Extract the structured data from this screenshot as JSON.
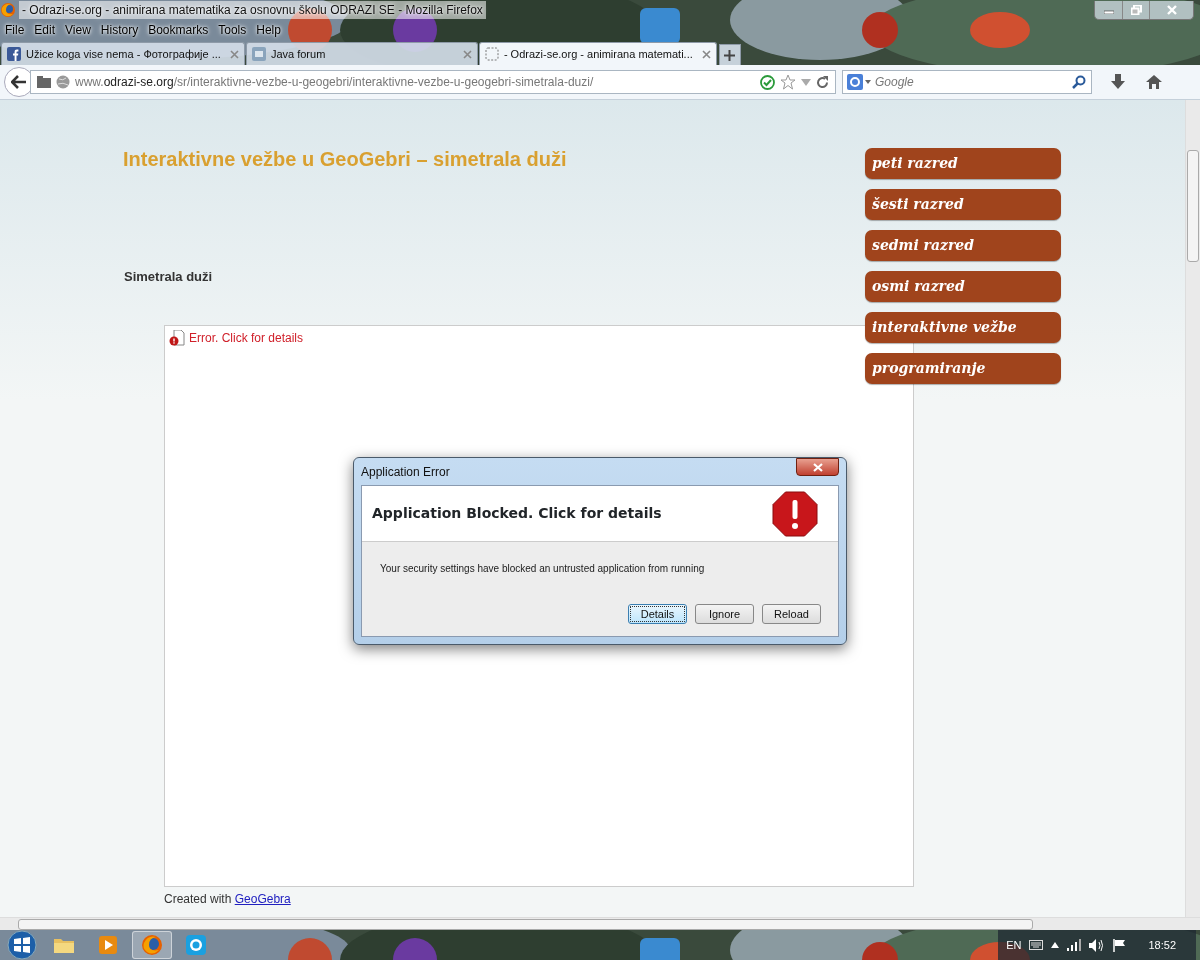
{
  "window": {
    "title": "- Odrazi-se.org - animirana matematika za osnovnu školu ODRAZI SE - Mozilla Firefox"
  },
  "menu": [
    {
      "label": "File"
    },
    {
      "label": "Edit"
    },
    {
      "label": "View"
    },
    {
      "label": "History"
    },
    {
      "label": "Bookmarks"
    },
    {
      "label": "Tools"
    },
    {
      "label": "Help"
    }
  ],
  "tabs": [
    {
      "label": "Užice koga vise nema - Фотографије ...",
      "selected": false
    },
    {
      "label": "Java forum",
      "selected": false
    },
    {
      "label": "- Odrazi-se.org - animirana matemati...",
      "selected": true
    }
  ],
  "address_bar": {
    "value": "www.**odrazi-se.org**/sr/interaktivne-vezbe-u-geogebri/interaktivne-vezbe-u-geogebri-simetrala-duzi/"
  },
  "search": {
    "placeholder": "Google"
  },
  "page": {
    "title": "Interaktivne vežbe u GeoGebri – simetrala duži",
    "subtitle": "Simetrala duži",
    "applet_error": "Error. Click for details",
    "footer_text": "Created with",
    "footer_link": "GeoGebra"
  },
  "nav": [
    {
      "label": "peti razred"
    },
    {
      "label": "šesti razred"
    },
    {
      "label": "sedmi razred"
    },
    {
      "label": "osmi razred"
    },
    {
      "label": "interaktivne vežbe"
    },
    {
      "label": "programiranje"
    }
  ],
  "dialog": {
    "title": "Application Error",
    "heading": "Application Blocked. Click for details",
    "message": "Your security settings have blocked an untrusted application from running",
    "buttons": [
      {
        "label": "Details",
        "selected": true
      },
      {
        "label": "Ignore",
        "selected": false
      },
      {
        "label": "Reload",
        "selected": false
      }
    ]
  },
  "taskbar": {
    "apps": [
      {
        "active": false
      },
      {
        "active": false
      },
      {
        "active": true
      },
      {
        "active": false
      }
    ],
    "language": "EN",
    "time": "18:52"
  }
}
